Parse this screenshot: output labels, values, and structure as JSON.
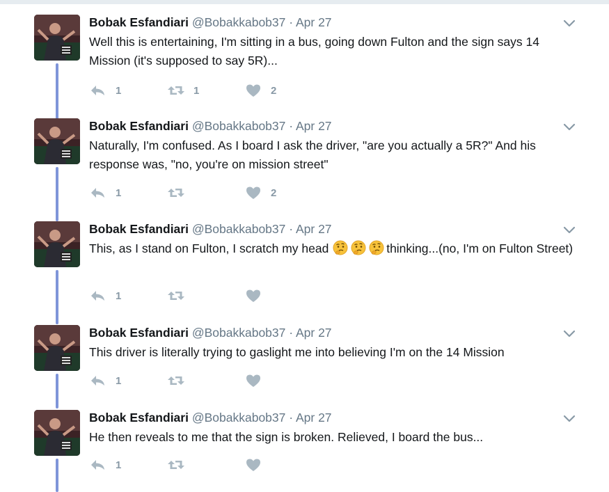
{
  "colors": {
    "thread_line": "#7f95d9",
    "icon": "#aab8c2",
    "muted": "#657786",
    "text": "#14171a"
  },
  "tweets": [
    {
      "name": "Bobak Esfandiari",
      "handle": "@Bobakkabob37",
      "dot": "·",
      "date": "Apr 27",
      "text": "Well this is entertaining, I'm sitting in a bus, going down Fulton and the sign says 14 Mission (it's supposed to say 5R)...",
      "replies": "1",
      "retweets": "1",
      "likes": "2"
    },
    {
      "name": "Bobak Esfandiari",
      "handle": "@Bobakkabob37",
      "dot": "·",
      "date": "Apr 27",
      "text": "Naturally, I'm confused. As I board I ask the driver, \"are you actually a 5R?\" And his response was, \"no, you're on mission street\"",
      "replies": "1",
      "retweets": "",
      "likes": "2"
    },
    {
      "name": "Bobak Esfandiari",
      "handle": "@Bobakkabob37",
      "dot": "·",
      "date": "Apr 27",
      "text_before": "This, as I stand on Fulton, I scratch my head ",
      "text_after": "thinking...(no, I'm on Fulton Street)",
      "emoji": "thinking-face-emoji",
      "replies": "1",
      "retweets": "",
      "likes": ""
    },
    {
      "name": "Bobak Esfandiari",
      "handle": "@Bobakkabob37",
      "dot": "·",
      "date": "Apr 27",
      "text": "This driver is literally trying to gaslight me into believing I'm on the 14 Mission",
      "replies": "1",
      "retweets": "",
      "likes": ""
    },
    {
      "name": "Bobak Esfandiari",
      "handle": "@Bobakkabob37",
      "dot": "·",
      "date": "Apr 27",
      "text": "He then reveals to me that the sign is broken. Relieved, I board the bus...",
      "replies": "1",
      "retweets": "",
      "likes": ""
    }
  ]
}
